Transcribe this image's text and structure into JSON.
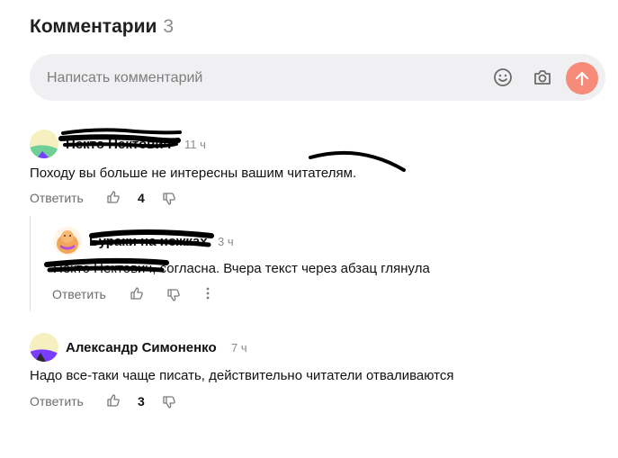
{
  "header": {
    "title": "Комментарии",
    "count": "3"
  },
  "composer": {
    "placeholder": "Написать комментарий"
  },
  "actions": {
    "reply": "Ответить"
  },
  "comments": [
    {
      "author": "Некто Нектович",
      "time": "11 ч",
      "text": "Походу вы больше не интересны вашим читателям.",
      "score": "4"
    },
    {
      "author": "Бураки на ножках",
      "time": "3 ч",
      "mention": "Некто Нектович",
      "text_rest": ", согласна. Вчера текст через абзац глянула"
    },
    {
      "author": "Александр Симоненко",
      "time": "7 ч",
      "text": "Надо все-таки чаще писать, действительно читатели отваливаются",
      "score": "3"
    }
  ],
  "colors": {
    "accent": "#f58b78",
    "composer_bg": "#f0f0f2"
  }
}
